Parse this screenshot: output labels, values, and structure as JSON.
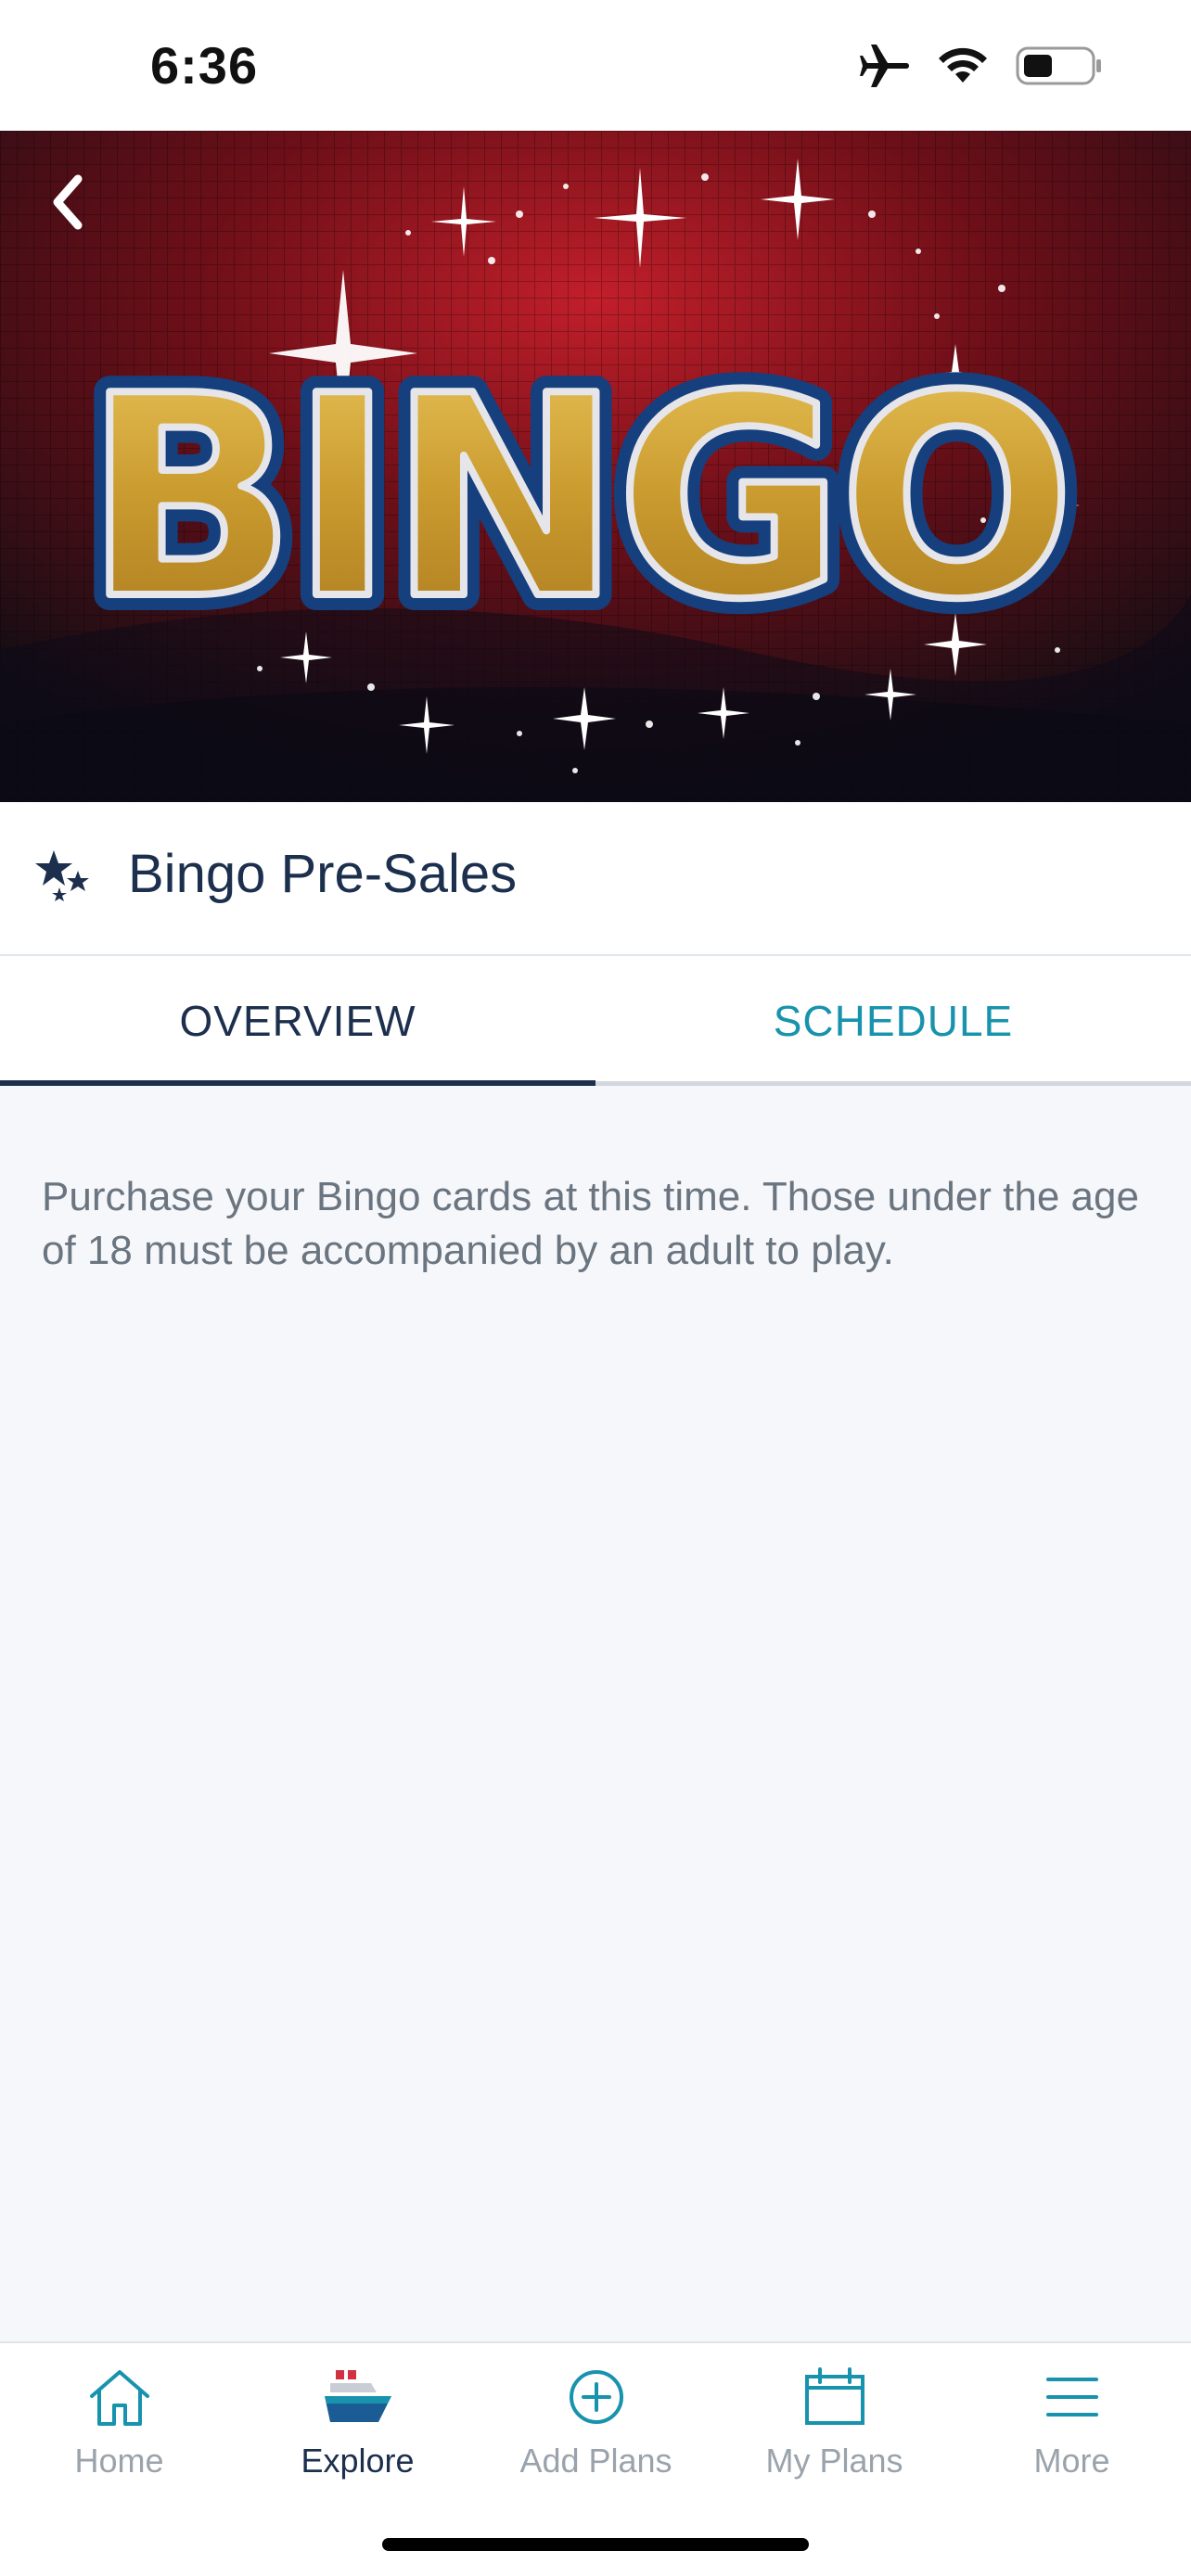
{
  "status_bar": {
    "time": "6:36",
    "icons": [
      "airplane-mode-icon",
      "wifi-icon",
      "battery-icon"
    ]
  },
  "hero": {
    "image_text": "BINGO",
    "back_icon": "chevron-left-icon"
  },
  "event": {
    "icon": "stars-icon",
    "title": "Bingo Pre-Sales"
  },
  "tabs": [
    {
      "label": "OVERVIEW",
      "active": true
    },
    {
      "label": "SCHEDULE",
      "active": false
    }
  ],
  "overview": {
    "description": "Purchase your Bingo cards at this time. Those under the age of 18 must be accompanied by an adult to play."
  },
  "tab_bar": {
    "items": [
      {
        "label": "Home",
        "icon": "home-icon",
        "active": false
      },
      {
        "label": "Explore",
        "icon": "ship-icon",
        "active": true
      },
      {
        "label": "Add Plans",
        "icon": "plus-circle-icon",
        "active": false
      },
      {
        "label": "My Plans",
        "icon": "calendar-icon",
        "active": false
      },
      {
        "label": "More",
        "icon": "menu-icon",
        "active": false
      }
    ]
  },
  "colors": {
    "navy": "#1c2f4d",
    "teal": "#1793ad",
    "inactive_gray": "#9aa3ab",
    "background": "#f6f7fb"
  }
}
